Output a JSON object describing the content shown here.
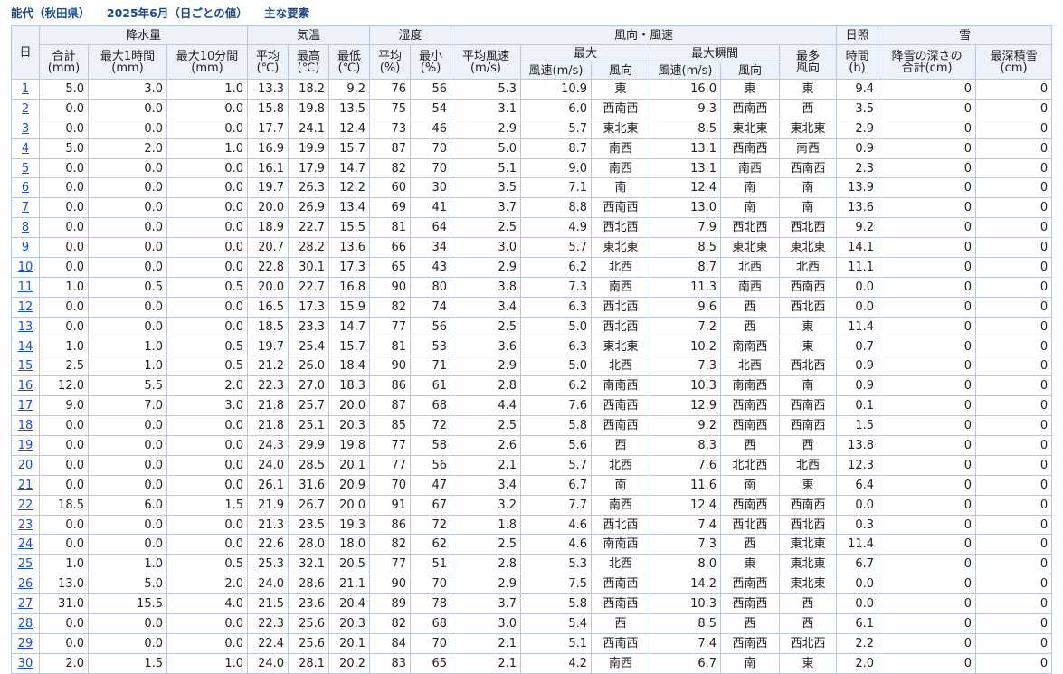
{
  "title": {
    "station": "能代（秋田県）",
    "period": "2025年6月（日ごとの値）",
    "kind": "主な要素"
  },
  "headers": {
    "day": "日",
    "precip": "降水量",
    "temp": "気温",
    "humid": "湿度",
    "wind": "風向・風速",
    "sun": "日照",
    "snow": "雪",
    "precip_total": "合計",
    "precip_total_u": "(mm)",
    "precip_1h": "最大1時間",
    "precip_1h_u": "(mm)",
    "precip_10m": "最大10分間",
    "precip_10m_u": "(mm)",
    "temp_avg": "平均",
    "temp_avg_u": "(℃)",
    "temp_max": "最高",
    "temp_max_u": "(℃)",
    "temp_min": "最低",
    "temp_min_u": "(℃)",
    "hum_avg": "平均",
    "hum_avg_u": "(%)",
    "hum_min": "最小",
    "hum_min_u": "(%)",
    "wind_avg": "平均風速",
    "wind_avg_u": "(m/s)",
    "wind_max": "最大",
    "wind_gust": "最大瞬間",
    "wind_mode": "最多",
    "wind_mode2": "風向",
    "speed": "風速(m/s)",
    "dir": "風向",
    "speed2": "風速(m/s)",
    "dir2": "風向",
    "sun_time": "時間",
    "sun_u": "(h)",
    "snow_depth": "降雪の深さの",
    "snow_depth2": "合計(cm)",
    "snow_max": "最深積雪",
    "snow_max_u": "(cm)"
  },
  "rows": [
    [
      "1",
      "5.0",
      "3.0",
      "1.0",
      "13.3",
      "18.2",
      "9.2",
      "76",
      "56",
      "5.3",
      "10.9",
      "東",
      "16.0",
      "東",
      "東",
      "9.4",
      "0",
      "0"
    ],
    [
      "2",
      "0.0",
      "0.0",
      "0.0",
      "15.8",
      "19.8",
      "13.5",
      "75",
      "54",
      "3.1",
      "6.0",
      "西南西",
      "9.3",
      "西南西",
      "西",
      "3.5",
      "0",
      "0"
    ],
    [
      "3",
      "0.0",
      "0.0",
      "0.0",
      "17.7",
      "24.1",
      "12.4",
      "73",
      "46",
      "2.9",
      "5.7",
      "東北東",
      "8.5",
      "東北東",
      "東北東",
      "2.9",
      "0",
      "0"
    ],
    [
      "4",
      "5.0",
      "2.0",
      "1.0",
      "16.9",
      "19.9",
      "15.7",
      "87",
      "70",
      "5.0",
      "8.7",
      "南西",
      "13.1",
      "西南西",
      "南西",
      "0.9",
      "0",
      "0"
    ],
    [
      "5",
      "0.0",
      "0.0",
      "0.0",
      "16.1",
      "17.9",
      "14.7",
      "82",
      "70",
      "5.1",
      "9.0",
      "南西",
      "13.1",
      "南西",
      "西南西",
      "2.3",
      "0",
      "0"
    ],
    [
      "6",
      "0.0",
      "0.0",
      "0.0",
      "19.7",
      "26.3",
      "12.2",
      "60",
      "30",
      "3.5",
      "7.1",
      "南",
      "12.4",
      "南",
      "南",
      "13.9",
      "0",
      "0"
    ],
    [
      "7",
      "0.0",
      "0.0",
      "0.0",
      "20.0",
      "26.9",
      "13.4",
      "69",
      "41",
      "3.7",
      "8.8",
      "西南西",
      "13.0",
      "南",
      "南",
      "13.6",
      "0",
      "0"
    ],
    [
      "8",
      "0.0",
      "0.0",
      "0.0",
      "18.9",
      "22.7",
      "15.5",
      "81",
      "64",
      "2.5",
      "4.9",
      "西北西",
      "7.9",
      "西北西",
      "西北西",
      "9.2",
      "0",
      "0"
    ],
    [
      "9",
      "0.0",
      "0.0",
      "0.0",
      "20.7",
      "28.2",
      "13.6",
      "66",
      "34",
      "3.0",
      "5.7",
      "東北東",
      "8.5",
      "東北東",
      "東北東",
      "14.1",
      "0",
      "0"
    ],
    [
      "10",
      "0.0",
      "0.0",
      "0.0",
      "22.8",
      "30.1",
      "17.3",
      "65",
      "43",
      "2.9",
      "6.2",
      "北西",
      "8.7",
      "北西",
      "北西",
      "11.1",
      "0",
      "0"
    ],
    [
      "11",
      "1.0",
      "0.5",
      "0.5",
      "20.0",
      "22.7",
      "16.8",
      "90",
      "80",
      "3.8",
      "7.3",
      "南西",
      "11.3",
      "南西",
      "西南西",
      "0.0",
      "0",
      "0"
    ],
    [
      "12",
      "0.0",
      "0.0",
      "0.0",
      "16.5",
      "17.3",
      "15.9",
      "82",
      "74",
      "3.4",
      "6.3",
      "西北西",
      "9.6",
      "西",
      "西北西",
      "0.0",
      "0",
      "0"
    ],
    [
      "13",
      "0.0",
      "0.0",
      "0.0",
      "18.5",
      "23.3",
      "14.7",
      "77",
      "56",
      "2.5",
      "5.0",
      "西北西",
      "7.2",
      "西",
      "東",
      "11.4",
      "0",
      "0"
    ],
    [
      "14",
      "1.0",
      "1.0",
      "0.5",
      "19.7",
      "25.4",
      "15.7",
      "81",
      "53",
      "3.6",
      "6.3",
      "東北東",
      "10.2",
      "南南西",
      "東",
      "0.7",
      "0",
      "0"
    ],
    [
      "15",
      "2.5",
      "1.0",
      "0.5",
      "21.2",
      "26.0",
      "18.4",
      "90",
      "71",
      "2.9",
      "5.0",
      "北西",
      "7.3",
      "北西",
      "西北西",
      "0.9",
      "0",
      "0"
    ],
    [
      "16",
      "12.0",
      "5.5",
      "2.0",
      "22.3",
      "27.0",
      "18.3",
      "86",
      "61",
      "2.8",
      "6.2",
      "南南西",
      "10.3",
      "南南西",
      "南",
      "0.9",
      "0",
      "0"
    ],
    [
      "17",
      "9.0",
      "7.0",
      "3.0",
      "21.8",
      "25.7",
      "20.0",
      "87",
      "68",
      "4.4",
      "7.6",
      "西南西",
      "12.9",
      "西南西",
      "西南西",
      "0.1",
      "0",
      "0"
    ],
    [
      "18",
      "0.0",
      "0.0",
      "0.0",
      "21.8",
      "25.1",
      "20.3",
      "85",
      "72",
      "2.5",
      "5.8",
      "西南西",
      "9.2",
      "西南西",
      "西南西",
      "1.5",
      "0",
      "0"
    ],
    [
      "19",
      "0.0",
      "0.0",
      "0.0",
      "24.3",
      "29.9",
      "19.8",
      "77",
      "58",
      "2.6",
      "5.6",
      "西",
      "8.3",
      "西",
      "西",
      "13.8",
      "0",
      "0"
    ],
    [
      "20",
      "0.0",
      "0.0",
      "0.0",
      "24.0",
      "28.5",
      "20.1",
      "77",
      "56",
      "2.1",
      "5.7",
      "北西",
      "7.6",
      "北北西",
      "北西",
      "12.3",
      "0",
      "0"
    ],
    [
      "21",
      "0.0",
      "0.0",
      "0.0",
      "26.1",
      "31.6",
      "20.9",
      "70",
      "47",
      "3.4",
      "6.7",
      "南",
      "11.6",
      "南",
      "東",
      "6.4",
      "0",
      "0"
    ],
    [
      "22",
      "18.5",
      "6.0",
      "1.5",
      "21.9",
      "26.7",
      "20.0",
      "91",
      "67",
      "3.2",
      "7.7",
      "南西",
      "12.4",
      "西南西",
      "西南西",
      "0.0",
      "0",
      "0"
    ],
    [
      "23",
      "0.0",
      "0.0",
      "0.0",
      "21.3",
      "23.5",
      "19.3",
      "86",
      "72",
      "1.8",
      "4.6",
      "西北西",
      "7.4",
      "西北西",
      "西北西",
      "0.3",
      "0",
      "0"
    ],
    [
      "24",
      "0.0",
      "0.0",
      "0.0",
      "22.6",
      "28.0",
      "18.0",
      "82",
      "62",
      "2.5",
      "4.6",
      "南南西",
      "7.3",
      "西",
      "東北東",
      "11.4",
      "0",
      "0"
    ],
    [
      "25",
      "1.0",
      "1.0",
      "0.5",
      "25.3",
      "32.1",
      "20.5",
      "77",
      "51",
      "2.8",
      "5.3",
      "北西",
      "8.0",
      "東",
      "東北東",
      "6.7",
      "0",
      "0"
    ],
    [
      "26",
      "13.0",
      "5.0",
      "2.0",
      "24.0",
      "28.6",
      "21.1",
      "90",
      "70",
      "2.9",
      "7.5",
      "西南西",
      "14.2",
      "西南西",
      "東北東",
      "0.0",
      "0",
      "0"
    ],
    [
      "27",
      "31.0",
      "15.5",
      "4.0",
      "21.5",
      "23.6",
      "20.4",
      "89",
      "78",
      "3.7",
      "5.8",
      "西南西",
      "10.3",
      "西南西",
      "西",
      "0.0",
      "0",
      "0"
    ],
    [
      "28",
      "0.0",
      "0.0",
      "0.0",
      "22.3",
      "25.6",
      "20.3",
      "82",
      "68",
      "3.0",
      "5.4",
      "西",
      "8.5",
      "西",
      "西",
      "6.1",
      "0",
      "0"
    ],
    [
      "29",
      "0.0",
      "0.0",
      "0.0",
      "22.4",
      "25.6",
      "20.1",
      "84",
      "70",
      "2.1",
      "5.1",
      "西南西",
      "7.4",
      "西南西",
      "西北西",
      "2.2",
      "0",
      "0"
    ],
    [
      "30",
      "2.0",
      "1.5",
      "1.0",
      "24.0",
      "28.1",
      "20.2",
      "83",
      "65",
      "2.1",
      "4.2",
      "南西",
      "6.7",
      "南",
      "東",
      "2.0",
      "0",
      "0"
    ]
  ],
  "colors": {
    "title": "#1a4a8a",
    "link": "#1a4ed6",
    "header_bg": "#edf2fa",
    "border": "#b9c7d9"
  }
}
